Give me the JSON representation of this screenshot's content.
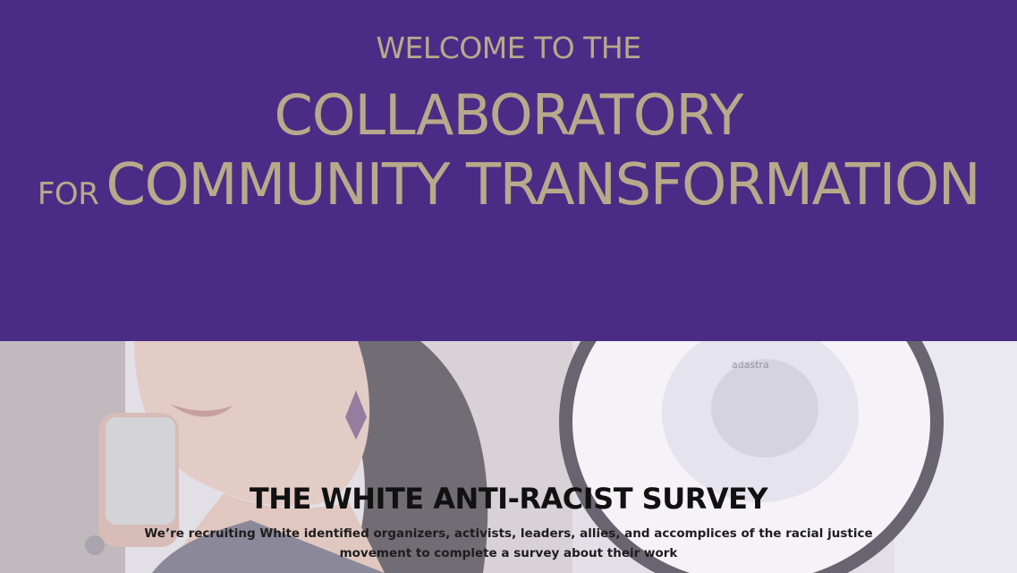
{
  "hero": {
    "line1": "WELCOME TO THE",
    "line2": "COLLABORATORY",
    "line3_prefix": "FOR",
    "line3_main": "COMMUNITY TRANSFORMATION",
    "background": "#4a2c86",
    "text_color": "#b9a98a"
  },
  "banner": {
    "image_description_icon": "woman-with-megaphone-photo",
    "megaphone_brand": "adastra"
  },
  "survey": {
    "title": "THE WHITE ANTI-RACIST SURVEY",
    "description": "We’re recruiting White identified organizers, activists, leaders, allies, and accomplices of the racial justice movement to complete a survey about their work"
  }
}
